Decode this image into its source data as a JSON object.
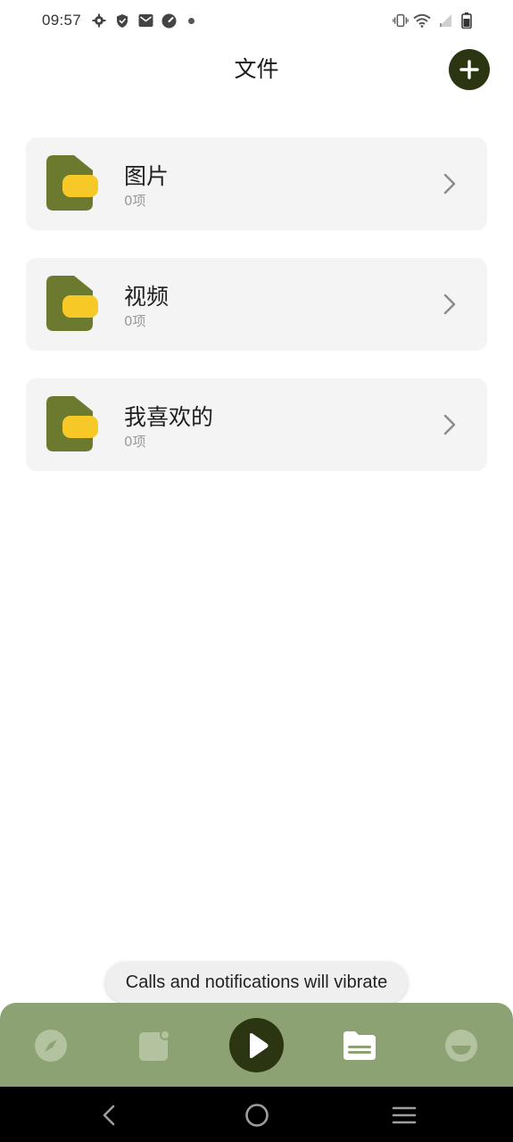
{
  "status_bar": {
    "time": "09:57",
    "left_icons": [
      "gear-icon",
      "shield-icon",
      "mail-icon",
      "speedometer-icon",
      "dot-icon"
    ],
    "right_icons": [
      "vibrate-icon",
      "wifi-icon",
      "signal-icon",
      "battery-icon"
    ]
  },
  "header": {
    "title": "文件",
    "add_icon": "plus-icon"
  },
  "folders": [
    {
      "name": "图片",
      "count": "0项"
    },
    {
      "name": "视频",
      "count": "0项"
    },
    {
      "name": "我喜欢的",
      "count": "0项"
    }
  ],
  "toast": {
    "text": "Calls and notifications will vibrate"
  },
  "bottom_nav": {
    "items": [
      "compass-icon",
      "note-icon",
      "play-icon",
      "folder-icon",
      "face-icon"
    ],
    "active": "folder-icon"
  },
  "system_nav": {
    "items": [
      "back-icon",
      "home-icon",
      "menu-icon"
    ]
  },
  "colors": {
    "accent_dark": "#2b3512",
    "folder_olive": "#6b7a2e",
    "folder_yellow": "#f6c927",
    "nav_green": "#8da272",
    "card_bg": "#f4f4f4"
  }
}
